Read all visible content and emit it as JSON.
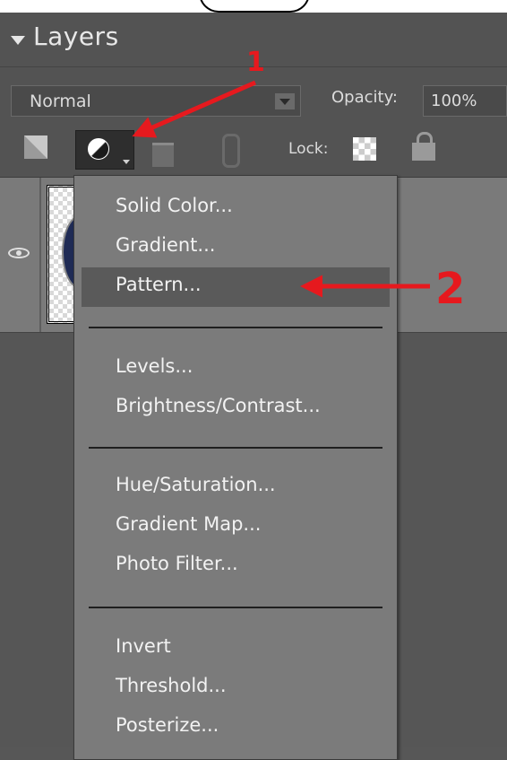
{
  "panel": {
    "title": "Layers",
    "blend_mode": "Normal",
    "opacity_label": "Opacity:",
    "opacity_value": "100%",
    "lock_label": "Lock:"
  },
  "menu": {
    "items": [
      "Solid Color...",
      "Gradient...",
      "Pattern...",
      "Levels...",
      "Brightness/Contrast...",
      "Hue/Saturation...",
      "Gradient Map...",
      "Photo Filter...",
      "Invert",
      "Threshold...",
      "Posterize..."
    ],
    "highlighted": "Pattern..."
  },
  "annotations": {
    "label_1": "1",
    "label_2": "2",
    "color": "#e6191e"
  },
  "icons": [
    "collapse-triangle-icon",
    "dropdown-arrow-icon",
    "new-layer-icon",
    "adjustment-layer-icon",
    "trash-icon",
    "link-icon",
    "lock-transparency-icon",
    "lock-all-icon",
    "eye-icon"
  ]
}
